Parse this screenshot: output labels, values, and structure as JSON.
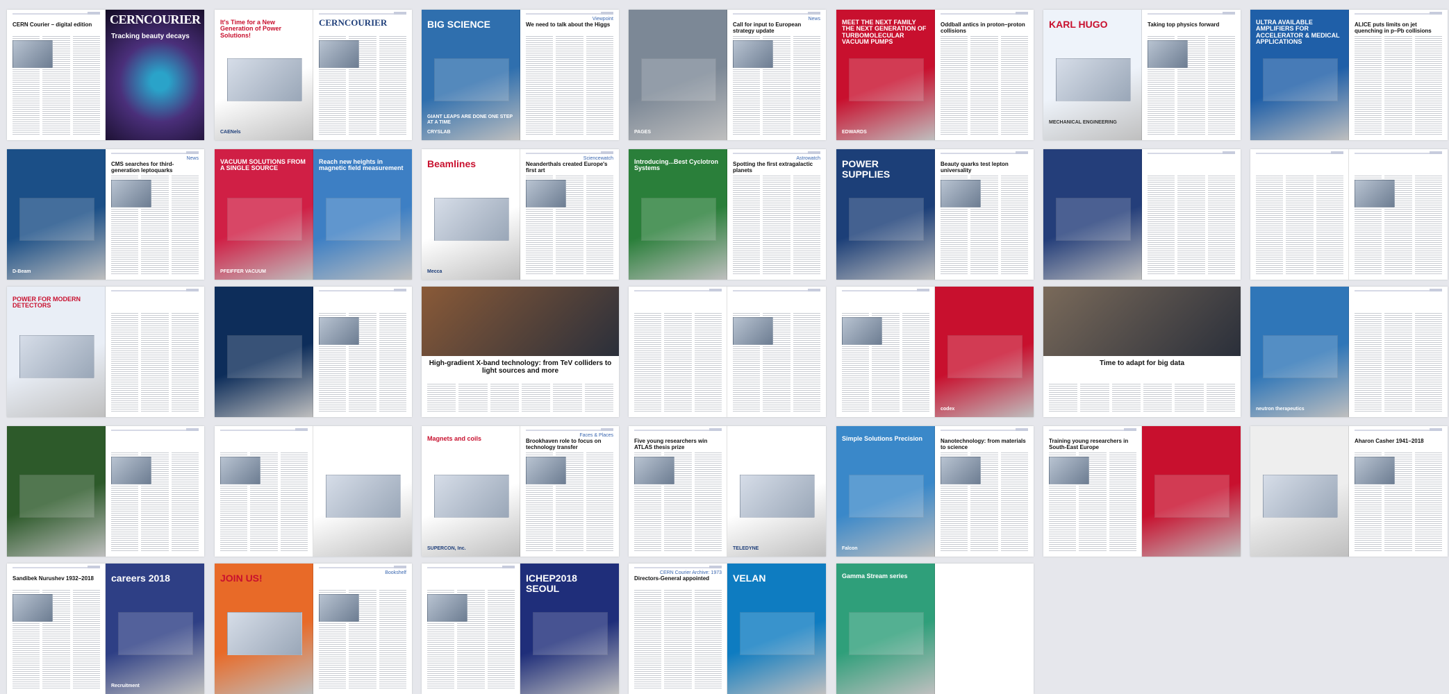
{
  "colors": {
    "background": "#e6e7ec",
    "section_blue": "#3a67b0",
    "cern_purple": "#6a3fa0",
    "ad_red": "#c8102e",
    "velan_blue": "#0e7cc1"
  },
  "spreads": [
    {
      "row": 1,
      "col": 1,
      "left": {
        "kind": "text",
        "title": "CERN Courier – digital edition",
        "section": ""
      },
      "right": {
        "kind": "cover",
        "masthead": "CERNCOURIER",
        "headline": "Tracking beauty decays",
        "bg": "#4a2f7a"
      }
    },
    {
      "row": 1,
      "col": 2,
      "left": {
        "kind": "ad",
        "headline": "It's Time for a New Generation of Power Solutions!",
        "bg": "#ffffff",
        "accent": "#c8102e",
        "brand": "CAENels"
      },
      "right": {
        "kind": "contents",
        "masthead": "CERNCOURIER"
      }
    },
    {
      "row": 1,
      "col": 3,
      "left": {
        "kind": "ad",
        "headline": "BIG SCIENCE",
        "sub": "GIANT LEAPS ARE DONE ONE STEP AT A TIME",
        "bg": "#2f6fae",
        "brand": "CRYSLAB"
      },
      "right": {
        "kind": "text",
        "section": "Viewpoint",
        "title": "We need to talk about the Higgs"
      }
    },
    {
      "row": 1,
      "col": 4,
      "left": {
        "kind": "ad",
        "headline": "",
        "bg": "#7c8896",
        "brand": "PAGES"
      },
      "right": {
        "kind": "text",
        "section": "News",
        "title": "Call for input to European strategy update"
      }
    },
    {
      "row": 1,
      "col": 5,
      "left": {
        "kind": "ad",
        "headline": "MEET THE NEXT FAMILY THE NEXT GENERATION OF TURBOMOLECULAR VACUUM PUMPS",
        "bg": "#c8102e",
        "brand": "EDWARDS"
      },
      "right": {
        "kind": "text",
        "section": "",
        "title": "Oddball antics in proton–proton collisions"
      }
    },
    {
      "row": 1,
      "col": 6,
      "left": {
        "kind": "ad",
        "headline": "KARL HUGO",
        "sub": "MECHANICAL ENGINEERING",
        "bg": "#eef3fa",
        "brand": ""
      },
      "right": {
        "kind": "text",
        "section": "",
        "title": "Taking top physics forward"
      }
    },
    {
      "row": 1,
      "col": 7,
      "left": {
        "kind": "ad",
        "headline": "ULTRA AVAILABLE AMPLIFIERS FOR ACCELERATOR & MEDICAL APPLICATIONS",
        "bg": "#1f5fa8",
        "brand": ""
      },
      "right": {
        "kind": "text",
        "section": "",
        "title": "ALICE puts limits on jet quenching in p–Pb collisions"
      }
    },
    {
      "row": 2,
      "col": 1,
      "left": {
        "kind": "ad",
        "headline": "",
        "bg": "#1b4f87",
        "brand": "D-Beam"
      },
      "right": {
        "kind": "text",
        "section": "News",
        "title": "CMS searches for third-generation leptoquarks"
      }
    },
    {
      "row": 2,
      "col": 2,
      "left": {
        "kind": "ad",
        "headline": "VACUUM SOLUTIONS FROM A SINGLE SOURCE",
        "bg": "#d01f45",
        "brand": "PFEIFFER VACUUM"
      },
      "right": {
        "kind": "ad",
        "headline": "Reach new heights in magnetic field measurement",
        "bg": "#3d7fc4",
        "brand": ""
      }
    },
    {
      "row": 2,
      "col": 3,
      "left": {
        "kind": "ad",
        "headline": "Beamlines",
        "bg": "#ffffff",
        "brand": "Mecca"
      },
      "right": {
        "kind": "text",
        "section": "Sciencewatch",
        "title": "Neanderthals created Europe's first art"
      }
    },
    {
      "row": 2,
      "col": 4,
      "left": {
        "kind": "ad",
        "headline": "Introducing...Best Cyclotron Systems",
        "bg": "#2a7f3a",
        "brand": ""
      },
      "right": {
        "kind": "text",
        "section": "Astrowatch",
        "title": "Spotting the first extragalactic planets"
      }
    },
    {
      "row": 2,
      "col": 5,
      "left": {
        "kind": "ad",
        "headline": "POWER SUPPLIES",
        "bg": "#1c3f78",
        "brand": ""
      },
      "right": {
        "kind": "text",
        "section": "",
        "title": "Beauty quarks test lepton universality"
      }
    },
    {
      "row": 2,
      "col": 6,
      "left": {
        "kind": "ad",
        "headline": "",
        "bg": "#243e7a",
        "brand": ""
      },
      "right": {
        "kind": "text",
        "section": "",
        "title": ""
      }
    },
    {
      "row": 2,
      "col": 7,
      "left": {
        "kind": "text",
        "section": "",
        "title": ""
      },
      "right": {
        "kind": "text",
        "section": "",
        "title": ""
      }
    },
    {
      "row": 3,
      "col": 1,
      "left": {
        "kind": "ad",
        "headline": "POWER FOR MODERN DETECTORS",
        "bg": "#e9eef6",
        "brand": ""
      },
      "right": {
        "kind": "text",
        "section": "",
        "title": ""
      }
    },
    {
      "row": 3,
      "col": 2,
      "left": {
        "kind": "ad",
        "headline": "",
        "bg": "#0d2d5a",
        "brand": ""
      },
      "right": {
        "kind": "text",
        "section": "",
        "title": ""
      }
    },
    {
      "row": 3,
      "col": 3,
      "left": {
        "kind": "feature",
        "headline": "High-gradient X-band technology: from TeV colliders to light sources and more",
        "bg": "#8a5a38",
        "brand": ""
      },
      "right": {
        "kind": "none"
      }
    },
    {
      "row": 3,
      "col": 4,
      "left": {
        "kind": "text",
        "section": "",
        "title": ""
      },
      "right": {
        "kind": "text",
        "section": "",
        "title": ""
      }
    },
    {
      "row": 3,
      "col": 5,
      "left": {
        "kind": "text",
        "section": "",
        "title": ""
      },
      "right": {
        "kind": "ad",
        "headline": "",
        "bg": "#c8102e",
        "brand": "codex"
      }
    },
    {
      "row": 3,
      "col": 6,
      "left": {
        "kind": "feature",
        "headline": "Time to adapt for big data",
        "bg": "#7a6a5a",
        "brand": ""
      },
      "right": {
        "kind": "none"
      }
    },
    {
      "row": 3,
      "col": 7,
      "left": {
        "kind": "ad",
        "headline": "",
        "bg": "#2f76b8",
        "brand": "neutron therapeutics"
      },
      "right": {
        "kind": "text",
        "section": "",
        "title": ""
      }
    },
    {
      "row": 4,
      "col": 1,
      "left": {
        "kind": "ad",
        "headline": "",
        "bg": "#2d5a2a",
        "brand": ""
      },
      "right": {
        "kind": "text",
        "section": "",
        "title": ""
      }
    },
    {
      "row": 4,
      "col": 2,
      "left": {
        "kind": "text",
        "section": "",
        "title": ""
      },
      "right": {
        "kind": "ad",
        "headline": "",
        "bg": "#ffffff",
        "brand": ""
      }
    },
    {
      "row": 4,
      "col": 3,
      "left": {
        "kind": "ad",
        "headline": "Magnets and coils",
        "bg": "#ffffff",
        "brand": "SUPERCON, Inc."
      },
      "right": {
        "kind": "text",
        "section": "Faces & Places",
        "title": "Brookhaven role to focus on technology transfer"
      }
    },
    {
      "row": 4,
      "col": 4,
      "left": {
        "kind": "text",
        "section": "",
        "title": "Five young researchers win ATLAS thesis prize"
      },
      "right": {
        "kind": "ad",
        "headline": "",
        "bg": "#ffffff",
        "brand": "TELEDYNE"
      }
    },
    {
      "row": 4,
      "col": 5,
      "left": {
        "kind": "ad",
        "headline": "Simple Solutions Precision",
        "bg": "#3a88c9",
        "brand": "Falcon"
      },
      "right": {
        "kind": "text",
        "section": "",
        "title": "Nanotechnology: from materials to science"
      }
    },
    {
      "row": 4,
      "col": 6,
      "left": {
        "kind": "text",
        "section": "",
        "title": "Training young researchers in South-East Europe"
      },
      "right": {
        "kind": "ad",
        "headline": "",
        "bg": "#c8102e",
        "brand": ""
      }
    },
    {
      "row": 4,
      "col": 7,
      "left": {
        "kind": "ad",
        "headline": "",
        "bg": "#eeeeee",
        "brand": ""
      },
      "right": {
        "kind": "text",
        "section": "",
        "title": "Aharon Casher 1941–2018"
      }
    },
    {
      "row": 5,
      "col": 1,
      "left": {
        "kind": "text",
        "section": "",
        "title": "Sandibek Nurushev 1932–2018"
      },
      "right": {
        "kind": "ad",
        "headline": "careers 2018",
        "bg": "#2e3f85",
        "brand": "Recruitment"
      }
    },
    {
      "row": 5,
      "col": 2,
      "left": {
        "kind": "ad",
        "headline": "JOIN US!",
        "bg": "#e86a28",
        "brand": ""
      },
      "right": {
        "kind": "text",
        "section": "Bookshelf",
        "title": ""
      }
    },
    {
      "row": 5,
      "col": 3,
      "left": {
        "kind": "text",
        "section": "",
        "title": ""
      },
      "right": {
        "kind": "ad",
        "headline": "ICHEP2018 SEOUL",
        "bg": "#1f2e7a",
        "brand": ""
      }
    },
    {
      "row": 5,
      "col": 4,
      "left": {
        "kind": "text",
        "section": "CERN Courier Archive: 1973",
        "title": "Directors-General appointed"
      },
      "right": {
        "kind": "ad",
        "headline": "VELAN",
        "bg": "#0e7cc1",
        "brand": ""
      }
    },
    {
      "row": 5,
      "col": 5,
      "left": {
        "kind": "ad",
        "headline": "Gamma Stream series",
        "bg": "#2f9f7a",
        "brand": ""
      },
      "right": {
        "kind": "none"
      }
    }
  ]
}
